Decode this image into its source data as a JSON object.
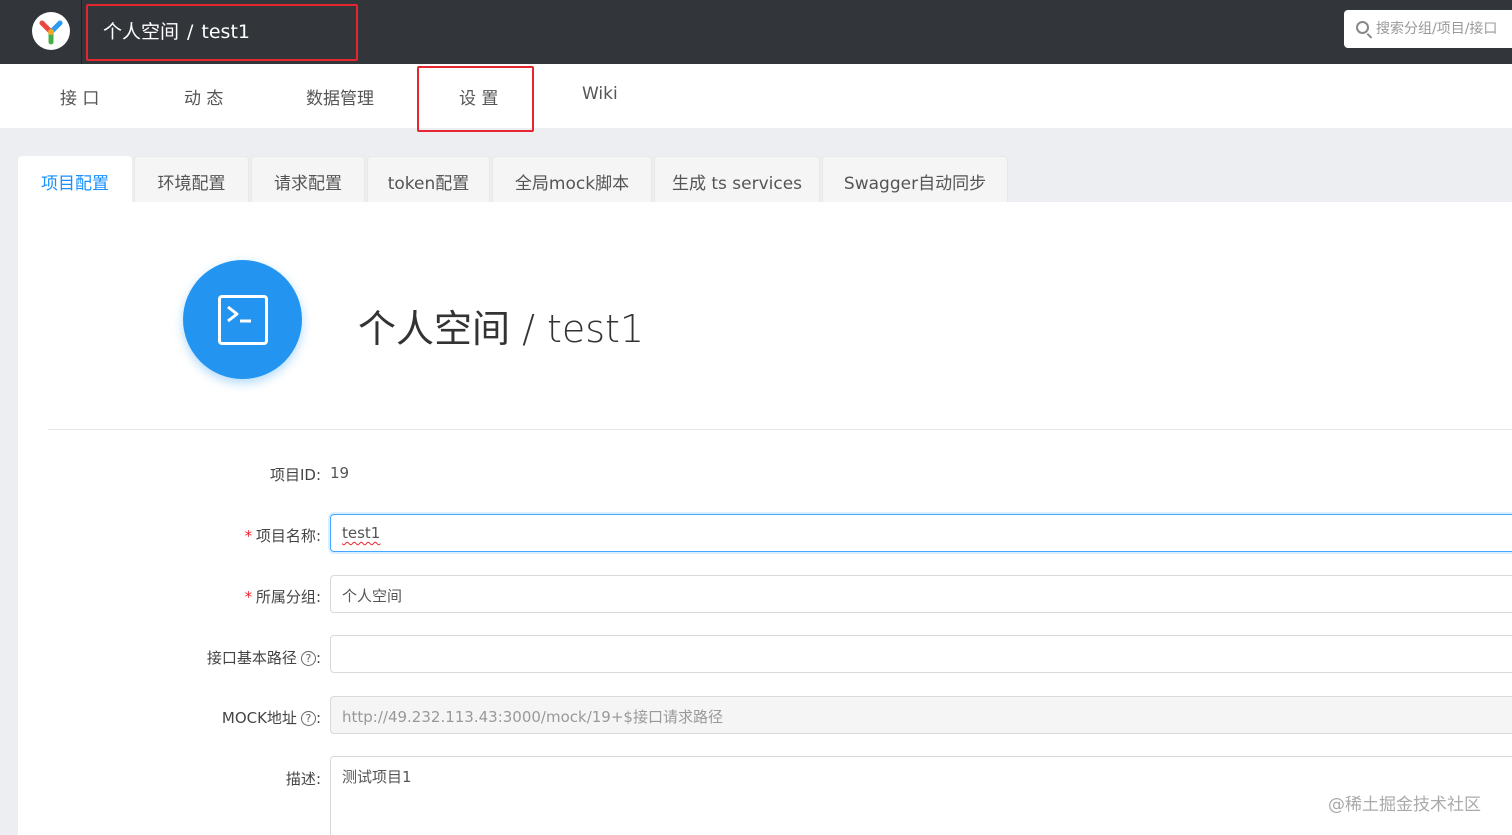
{
  "header": {
    "breadcrumb": {
      "group": "个人空间",
      "separator": "/",
      "project": "test1"
    },
    "search": {
      "placeholder": "搜索分组/项目/接口"
    },
    "logo_icon": "yapi-logo-icon"
  },
  "nav": {
    "items": [
      {
        "label": "接 口"
      },
      {
        "label": "动 态"
      },
      {
        "label": "数据管理"
      },
      {
        "label": "设 置"
      },
      {
        "label": "Wiki"
      }
    ]
  },
  "settings": {
    "tabs": [
      {
        "label": "项目配置",
        "active": true
      },
      {
        "label": "环境配置"
      },
      {
        "label": "请求配置"
      },
      {
        "label": "token配置"
      },
      {
        "label": "全局mock脚本"
      },
      {
        "label": "生成 ts services"
      },
      {
        "label": "Swagger自动同步"
      }
    ],
    "project_icon": "terminal-icon",
    "project_title": "个人空间 / test1",
    "form": {
      "id_label": "项目ID",
      "id_value": "19",
      "name_label": "项目名称",
      "name_value": "test1",
      "group_label": "所属分组",
      "group_value": "个人空间",
      "basepath_label": "接口基本路径",
      "basepath_value": "",
      "mock_label": "MOCK地址",
      "mock_value": "http://49.232.113.43:3000/mock/19+$接口请求路径",
      "desc_label": "描述",
      "desc_value": "测试项目1",
      "required_mark": "*",
      "colon": ":",
      "help_glyph": "?"
    }
  },
  "watermark": "@稀土掘金技术社区",
  "colors": {
    "accent": "#1890ff",
    "topbar": "#32363a",
    "highlight": "#e3262f",
    "avatar": "#2395f1"
  }
}
